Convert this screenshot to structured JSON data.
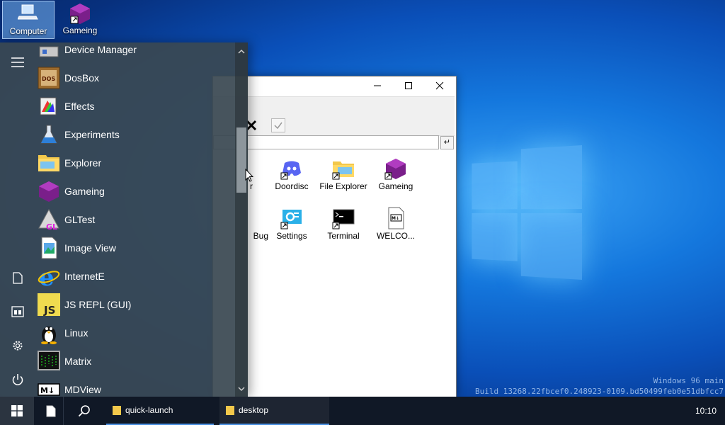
{
  "desktop": {
    "icons": [
      {
        "label": "Computer",
        "icon": "computer-icon"
      },
      {
        "label": "Gameing",
        "icon": "gameing-icon"
      }
    ],
    "build": {
      "line1": "Windows 96 main",
      "line2": "Build 13268.22fbcef0.248923-0109.bd50499feb0e51dbfcc7"
    }
  },
  "window": {
    "files": [
      {
        "label": "r"
      },
      {
        "label": "Doordisc"
      },
      {
        "label": "File Explorer"
      },
      {
        "label": "Gameing"
      },
      {
        "label": "Bug"
      },
      {
        "label": "Settings"
      },
      {
        "label": "Terminal"
      },
      {
        "label": "WELCO..."
      }
    ],
    "go_label": "↵"
  },
  "start_menu": {
    "items": [
      {
        "label": "Device Manager",
        "icon": "device-manager-icon"
      },
      {
        "label": "DosBox",
        "icon": "dosbox-icon"
      },
      {
        "label": "Effects",
        "icon": "effects-icon"
      },
      {
        "label": "Experiments",
        "icon": "flask-icon"
      },
      {
        "label": "Explorer",
        "icon": "folder-icon"
      },
      {
        "label": "Gameing",
        "icon": "gameing-icon"
      },
      {
        "label": "GLTest",
        "icon": "gltest-icon"
      },
      {
        "label": "Image View",
        "icon": "image-icon"
      },
      {
        "label": "InternetE",
        "icon": "internet-icon"
      },
      {
        "label": "JS REPL (GUI)",
        "icon": "js-icon"
      },
      {
        "label": "Linux",
        "icon": "linux-icon"
      },
      {
        "label": "Matrix",
        "icon": "matrix-icon"
      },
      {
        "label": "MDView",
        "icon": "markdown-icon"
      }
    ],
    "js_badge": "JS",
    "gl_badge": "GL",
    "dos_badge": "DOS",
    "md_badge": "M↓"
  },
  "taskbar": {
    "tasks": [
      {
        "label": "quick-launch"
      },
      {
        "label": "desktop"
      }
    ],
    "clock": "10:10"
  },
  "colors": {
    "accent": "#0a6fd8",
    "taskbar": "#101826",
    "menu": "#3a4852"
  }
}
